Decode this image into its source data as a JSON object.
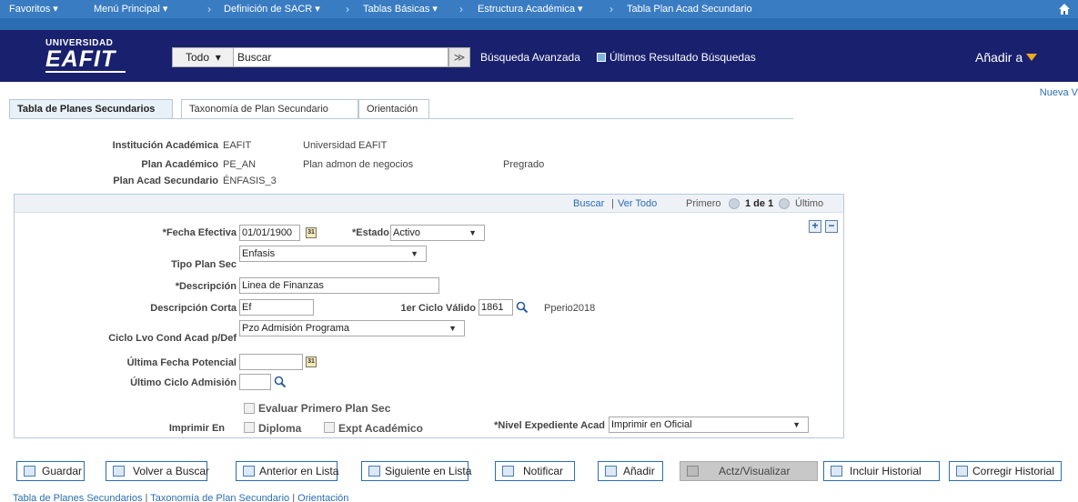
{
  "topnav": {
    "favorites": "Favoritos",
    "main_menu": "Menú Principal",
    "crumb1": "Definición de SACR",
    "crumb2": "Tablas Básicas",
    "crumb3": "Estructura Académica",
    "crumb4": "Tabla Plan Acad Secundario"
  },
  "header": {
    "logo_line1": "UNIVERSIDAD",
    "logo_line2": "EAFIT",
    "search_scope": "Todo",
    "search_placeholder": "Buscar",
    "search_go": "≫",
    "advanced_search": "Búsqueda Avanzada",
    "recent_search": "Últimos Resultado Búsquedas",
    "add_to": "Añadir a"
  },
  "new_window": "Nueva V",
  "tabs": [
    {
      "label": "Tabla de Planes Secundarios",
      "active": true
    },
    {
      "label": "Taxonomía de Plan Secundario",
      "active": false
    },
    {
      "label": "Orientación",
      "active": false
    }
  ],
  "key": {
    "institution_label": "Institución Académica",
    "institution_code": "EAFIT",
    "institution_name": "Universidad EAFIT",
    "plan_label": "Plan Académico",
    "plan_code": "PE_AN",
    "plan_name": "Plan admon de negocios",
    "plan_level": "Pregrado",
    "subplan_label": "Plan Acad Secundario",
    "subplan_code": "ÉNFASIS_3"
  },
  "box": {
    "find": "Buscar",
    "view_all": "Ver Todo",
    "first": "Primero",
    "page_info": "1 de 1",
    "last": "Último"
  },
  "form": {
    "eff_date_label": "*Fecha Efectiva",
    "eff_date_value": "01/01/1900",
    "status_label": "*Estado",
    "status_value": "Activo",
    "type_label": "Tipo Plan Sec",
    "type_value": "Enfasis",
    "descr_label": "*Descripción",
    "descr_value": "Linea de Finanzas",
    "short_label": "Descripción Corta",
    "short_value": "Ef",
    "first_term_label": "1er Ciclo Válido",
    "first_term_value": "1861",
    "first_term_descr": "Pperio2018",
    "cycle_label": "Ciclo Lvo Cond Acad p/Def",
    "cycle_value": "Pzo Admisión Programa",
    "last_date_label": "Última Fecha Potencial",
    "last_date_value": "",
    "last_admit_label": "Último Ciclo Admisión",
    "last_admit_value": "",
    "eval_first_label": "Evaluar Primero Plan Sec",
    "print_label": "Imprimir En",
    "diploma_label": "Diploma",
    "transcript_label": "Expt Académico",
    "level_label": "*Nivel Expediente Acad",
    "level_value": "Imprimir en Oficial"
  },
  "toolbar": {
    "save": "Guardar",
    "return": "Volver a Buscar",
    "prev": "Anterior en Lista",
    "next": "Siguiente en Lista",
    "notify": "Notificar",
    "add": "Añadir",
    "update": "Actz/Visualizar",
    "include_history": "Incluir Historial",
    "correct_history": "Corregir Historial"
  },
  "footer": {
    "link1": "Tabla de Planes Secundarios",
    "link2": "Taxonomía de Plan Secundario",
    "link3": "Orientación"
  }
}
